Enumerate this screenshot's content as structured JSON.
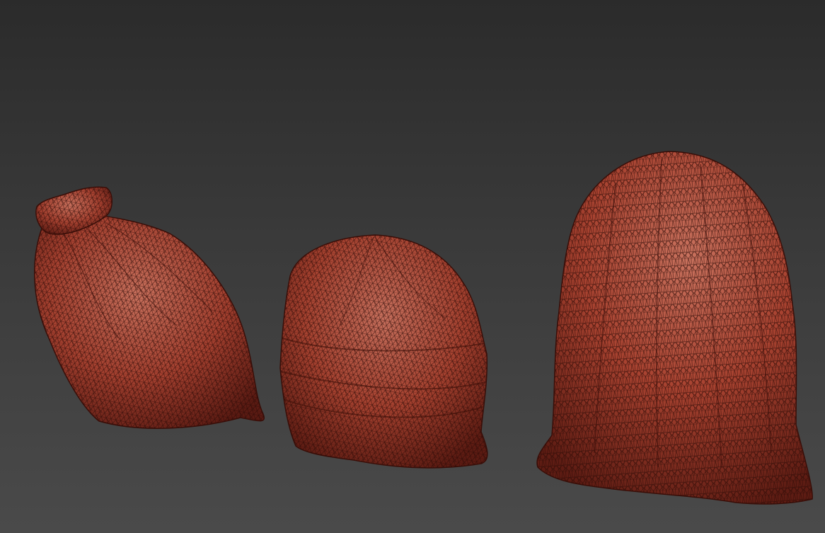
{
  "scene": {
    "type": "3d-viewport-render",
    "background_top": "#2b2b2b",
    "background_bottom": "#4a4a4a",
    "mesh_color": "#a8402f",
    "mesh_highlight": "#c96a55",
    "wire_color": "#2a0a06",
    "objects": [
      {
        "id": "bag-left",
        "kind": "tied-garbage-bag"
      },
      {
        "id": "bag-middle",
        "kind": "squat-garbage-bag"
      },
      {
        "id": "bag-right",
        "kind": "tall-garbage-bag"
      }
    ]
  }
}
